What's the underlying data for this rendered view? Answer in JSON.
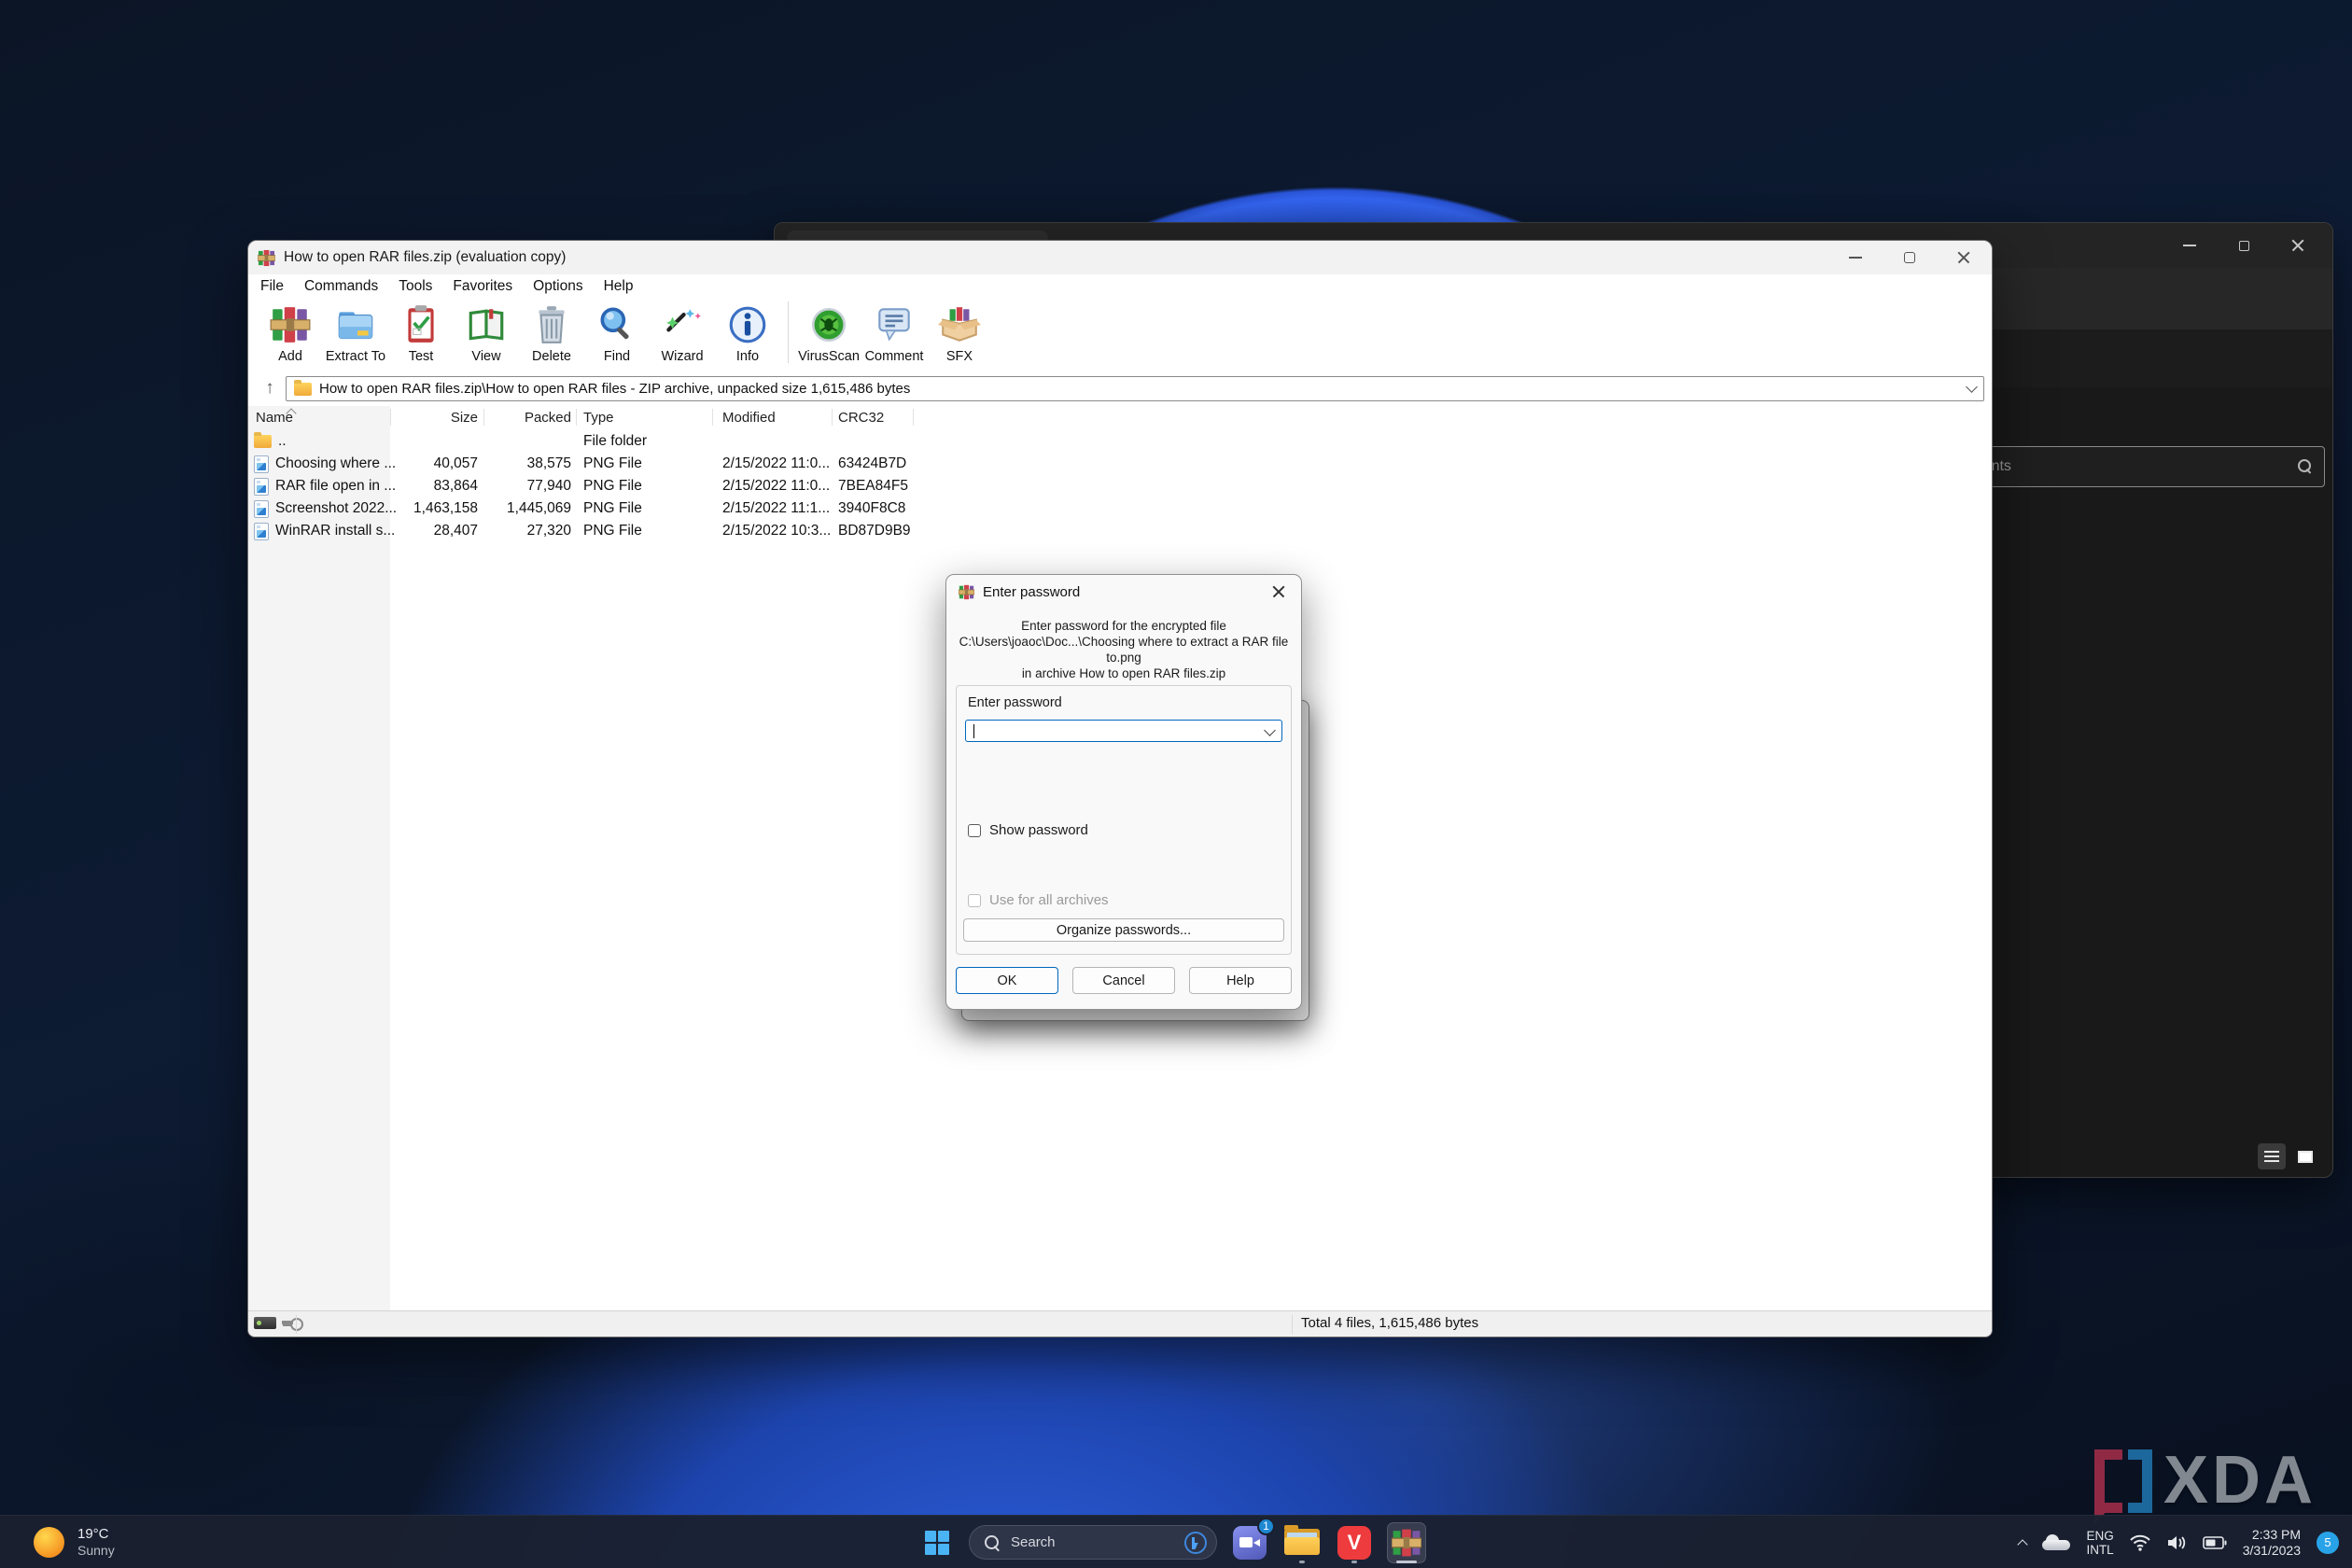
{
  "colors": {
    "accent": "#0067c0",
    "winrar_green": "#2f9e45",
    "winrar_red": "#cf4049",
    "winrar_purple": "#7a57a5",
    "vivaldi_red": "#ee3b3e",
    "taskbar_bg": "#1a2030"
  },
  "weather": {
    "temp": "19°C",
    "condition": "Sunny"
  },
  "watermark": {
    "text": "XDA"
  },
  "explorer_window": {
    "search_value": "Documents"
  },
  "winrar": {
    "title": "How to open RAR files.zip (evaluation copy)",
    "menu": [
      "File",
      "Commands",
      "Tools",
      "Favorites",
      "Options",
      "Help"
    ],
    "toolbar": [
      "Add",
      "Extract To",
      "Test",
      "View",
      "Delete",
      "Find",
      "Wizard",
      "Info",
      "VirusScan",
      "Comment",
      "SFX"
    ],
    "address": "How to open RAR files.zip\\How to open RAR files - ZIP archive, unpacked size 1,615,486 bytes",
    "columns": [
      "Name",
      "Size",
      "Packed",
      "Type",
      "Modified",
      "CRC32"
    ],
    "sort_column": "Name",
    "rows": [
      {
        "name": "..",
        "size": "",
        "packed": "",
        "type": "File folder",
        "modified": "",
        "crc": "",
        "icon": "folder"
      },
      {
        "name": "Choosing where ...",
        "size": "40,057",
        "packed": "38,575",
        "type": "PNG File",
        "modified": "2/15/2022 11:0...",
        "crc": "63424B7D",
        "icon": "png"
      },
      {
        "name": "RAR file open in ...",
        "size": "83,864",
        "packed": "77,940",
        "type": "PNG File",
        "modified": "2/15/2022 11:0...",
        "crc": "7BEA84F5",
        "icon": "png"
      },
      {
        "name": "Screenshot 2022...",
        "size": "1,463,158",
        "packed": "1,445,069",
        "type": "PNG File",
        "modified": "2/15/2022 11:1...",
        "crc": "3940F8C8",
        "icon": "png"
      },
      {
        "name": "WinRAR install s...",
        "size": "28,407",
        "packed": "27,320",
        "type": "PNG File",
        "modified": "2/15/2022 10:3...",
        "crc": "BD87D9B9",
        "icon": "png"
      }
    ],
    "status_total": "Total 4 files, 1,615,486 bytes"
  },
  "dialog": {
    "title": "Enter password",
    "message": [
      "Enter password for the encrypted file",
      "C:\\Users\\joaoc\\Doc...\\Choosing where to extract a RAR file to.png",
      "in archive How to open RAR files.zip"
    ],
    "field_label": "Enter password",
    "input_value": "",
    "show_password_label": "Show password",
    "use_all_label": "Use for all archives",
    "organize_label": "Organize passwords...",
    "ok_label": "OK",
    "cancel_label": "Cancel",
    "help_label": "Help"
  },
  "taskbar": {
    "search_placeholder": "Search",
    "chat_badge": "1",
    "tray": {
      "lang1": "ENG",
      "lang2": "INTL",
      "time": "2:33 PM",
      "date": "3/31/2023",
      "badge": "5"
    }
  }
}
